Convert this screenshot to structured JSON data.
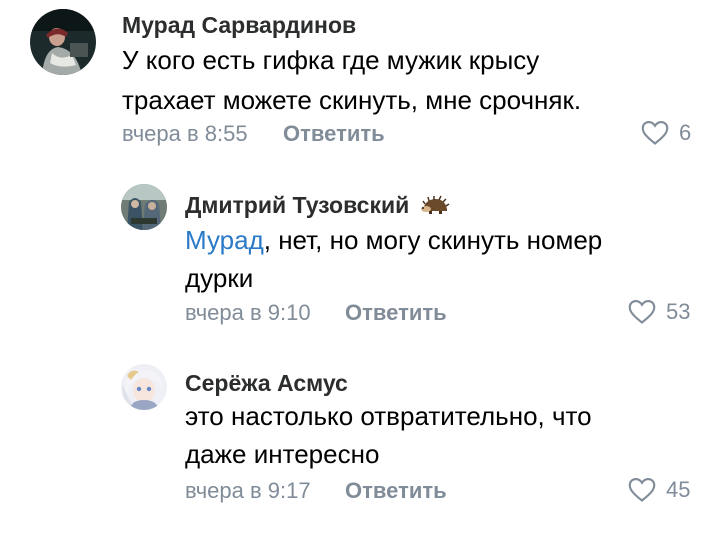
{
  "comments": [
    {
      "author": "Мурад Сарвардинов",
      "lines": [
        "У кого есть гифка где мужик крысу",
        "трахает можете скинуть, мне срочняк."
      ],
      "time": "вчера в 8:55",
      "reply_label": "Ответить",
      "likes": "6"
    },
    {
      "author": "Дмитрий Тузовский",
      "mention": "Мурад",
      "lines": [
        ", нет, но могу скинуть номер",
        "дурки"
      ],
      "time": "вчера в 9:10",
      "reply_label": "Ответить",
      "likes": "53"
    },
    {
      "author": "Серёжа Асмус",
      "lines": [
        "это настолько отвратительно, что",
        "даже интересно"
      ],
      "time": "вчера в 9:17",
      "reply_label": "Ответить",
      "likes": "45"
    }
  ],
  "colors": {
    "author": "#2c2d2e",
    "secondary": "#818c99",
    "mention": "#2a7ac7",
    "text": "#000000"
  }
}
